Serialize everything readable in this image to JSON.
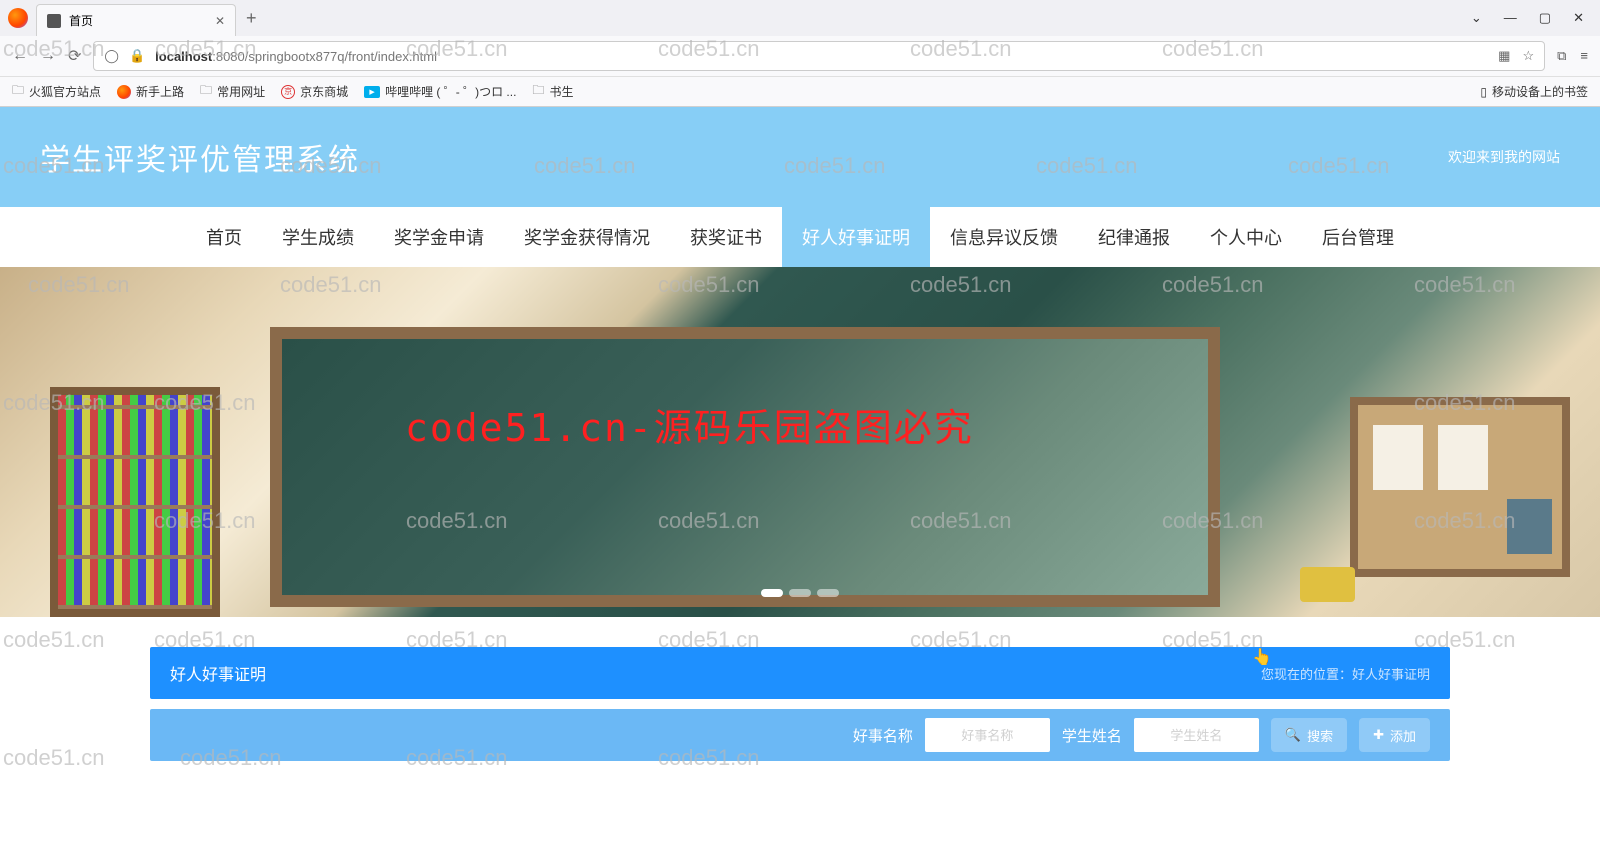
{
  "watermark_text": "code51.cn",
  "browser": {
    "tab_title": "首页",
    "url_host": "localhost",
    "url_port_path": ":8080/springbootx877q/front/index.html",
    "bookmarks": [
      "火狐官方站点",
      "新手上路",
      "常用网址",
      "京东商城",
      "哔哩哔哩 (  ゜- ゜)つロ ...",
      "书生"
    ],
    "mobile_bookmarks": "移动设备上的书签"
  },
  "page": {
    "site_title": "学生评奖评优管理系统",
    "welcome": "欢迎来到我的网站",
    "nav": [
      "首页",
      "学生成绩",
      "奖学金申请",
      "奖学金获得情况",
      "获奖证书",
      "好人好事证明",
      "信息异议反馈",
      "纪律通报",
      "个人中心",
      "后台管理"
    ],
    "nav_active_index": 5,
    "banner_overlay_text": "code51.cn-源码乐园盗图必究",
    "breadcrumb": {
      "title": "好人好事证明",
      "location_prefix": "您现在的位置：",
      "location_value": "好人好事证明"
    },
    "filter": {
      "label1": "好事名称",
      "placeholder1": "好事名称",
      "label2": "学生姓名",
      "placeholder2": "学生姓名",
      "search_btn": "搜索",
      "add_btn": "添加"
    }
  }
}
